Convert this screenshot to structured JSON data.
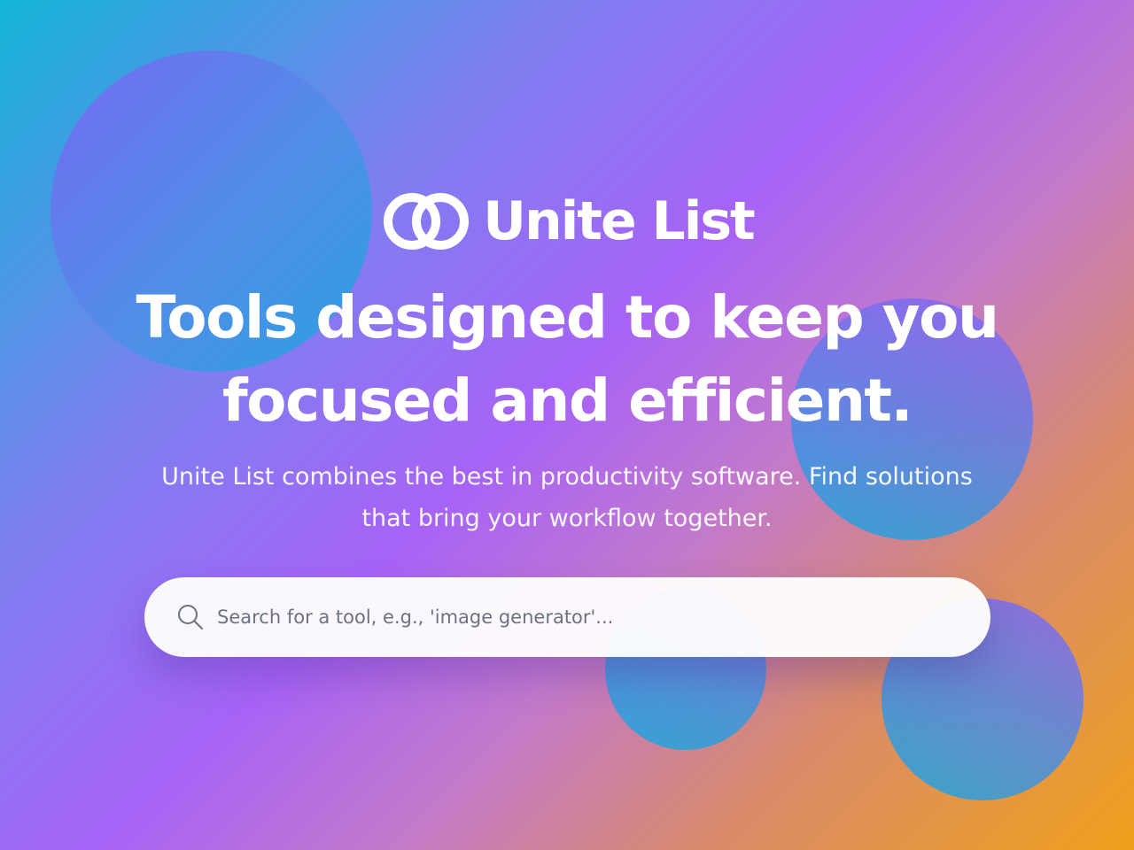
{
  "brand": {
    "name": "Unite List",
    "logo_icon": "interlocking-rings-icon"
  },
  "hero": {
    "headline_line1": "Tools designed to keep you",
    "headline_line2": "focused and efficient.",
    "subtitle_line1": "Unite List combines the best in productivity software. Find solutions",
    "subtitle_line2": "that bring your workflow together."
  },
  "search": {
    "icon": "search-icon",
    "placeholder": "Search for a tool, e.g., 'image generator'...",
    "value": ""
  },
  "colors": {
    "gradient_start": "#12b4d8",
    "gradient_mid": "#a763f6",
    "gradient_end": "#f0a11b",
    "text": "#ffffff"
  }
}
